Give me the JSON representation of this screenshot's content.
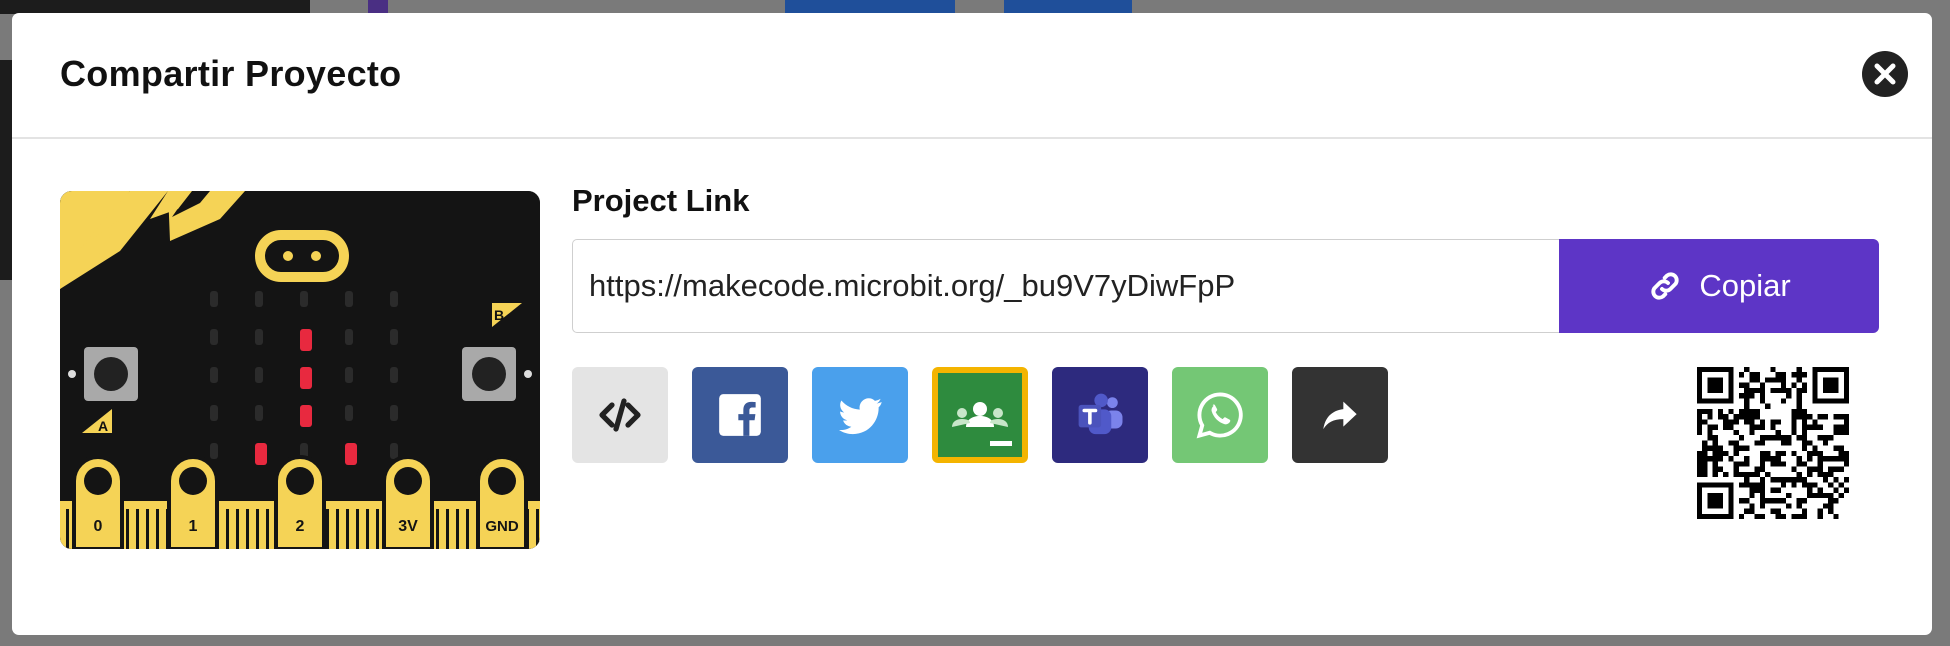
{
  "modal": {
    "title": "Compartir Proyecto"
  },
  "device": {
    "pin_labels": [
      "0",
      "1",
      "2",
      "3V",
      "GND"
    ],
    "button_a": "A",
    "button_b": "B"
  },
  "link": {
    "label": "Project Link",
    "value": "https://makecode.microbit.org/_bu9V7yDiwFpP",
    "copy_label": "Copiar"
  },
  "share_buttons": [
    {
      "icon": "embed-code-icon",
      "color": "#e4e4e4"
    },
    {
      "icon": "facebook-icon",
      "color": "#3b5998"
    },
    {
      "icon": "twitter-icon",
      "color": "#4aa0ec"
    },
    {
      "icon": "google-classroom-icon",
      "color": "#2e7d32",
      "border": "#f4b400"
    },
    {
      "icon": "microsoft-teams-icon",
      "color": "#2d2a7e"
    },
    {
      "icon": "whatsapp-icon",
      "color": "#74c775"
    },
    {
      "icon": "share-icon",
      "color": "#333333"
    }
  ],
  "colors": {
    "accent": "#5d35c6",
    "led_on": "#e8293f"
  }
}
